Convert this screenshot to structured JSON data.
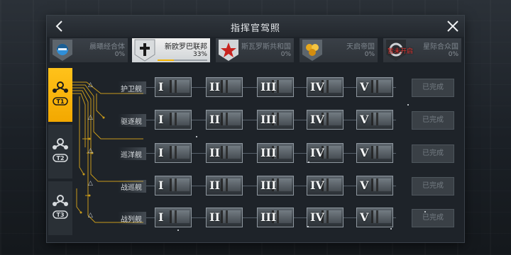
{
  "header": {
    "title": "指挥官驾照"
  },
  "factions": [
    {
      "name": "晨曦经合体",
      "percent": "0%",
      "active": false,
      "icon": "dawn-icon",
      "color": "#2f8fd8"
    },
    {
      "name": "新欧罗巴联邦",
      "percent": "33%",
      "active": true,
      "icon": "cross-icon",
      "progress": 0.33
    },
    {
      "name": "斯瓦罗斯共和国",
      "percent": "0%",
      "active": false,
      "icon": "red-star-icon",
      "color": "#c8231f"
    },
    {
      "name": "天启帝国",
      "percent": "0%",
      "active": false,
      "icon": "orbs-icon",
      "color": "#e7a81c"
    },
    {
      "name": "星际合众国",
      "percent": "0%",
      "active": false,
      "icon": "nexus-icon",
      "locked_text": "暂未开启"
    }
  ],
  "tiers": [
    {
      "label": "T1",
      "active": true
    },
    {
      "label": "T2",
      "active": false
    },
    {
      "label": "T3",
      "active": false
    }
  ],
  "levels": [
    "I",
    "II",
    "III",
    "IV",
    "V"
  ],
  "rows": [
    {
      "name": "护卫舰",
      "status": "已完成"
    },
    {
      "name": "驱逐舰",
      "status": "已完成"
    },
    {
      "name": "巡洋舰",
      "status": "已完成"
    },
    {
      "name": "战巡舰",
      "status": "已完成"
    },
    {
      "name": "战列舰",
      "status": "已完成"
    }
  ],
  "colors": {
    "accent": "#f3b200",
    "panel": "#1e2329"
  }
}
